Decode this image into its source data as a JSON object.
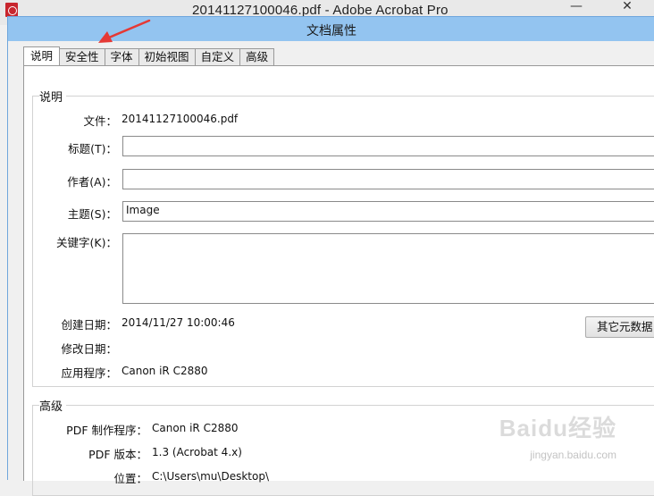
{
  "background_window": {
    "title": "20141127100046.pdf - Adobe Acrobat Pro",
    "minimize_glyph": "—",
    "close_glyph": "✕"
  },
  "dialog": {
    "title": "文档属性",
    "header_color": "#93c4f0"
  },
  "tabs": [
    {
      "label": "说明",
      "active": true
    },
    {
      "label": "安全性",
      "active": false
    },
    {
      "label": "字体",
      "active": false
    },
    {
      "label": "初始视图",
      "active": false
    },
    {
      "label": "自定义",
      "active": false
    },
    {
      "label": "高级",
      "active": false
    }
  ],
  "description": {
    "group_title": "说明",
    "file_label": "文件：",
    "file_value": "20141127100046.pdf",
    "title_label": "标题(T)：",
    "title_value": "",
    "author_label": "作者(A)：",
    "author_value": "",
    "subject_label": "主题(S)：",
    "subject_value": "Image",
    "keywords_label": "关键字(K)：",
    "keywords_value": "",
    "created_label": "创建日期：",
    "created_value": "2014/11/27 10:00:46",
    "modified_label": "修改日期：",
    "modified_value": "",
    "app_label": "应用程序：",
    "app_value": "Canon iR C2880",
    "more_metadata_button": "其它元数据"
  },
  "advanced": {
    "group_title": "高级",
    "producer_label": "PDF 制作程序：",
    "producer_value": "Canon iR C2880",
    "version_label": "PDF 版本：",
    "version_value": "1.3 (Acrobat 4.x)",
    "location_label": "位置：",
    "location_value": "C:\\Users\\mu\\Desktop\\"
  },
  "annotation": {
    "arrow_color": "#e53935"
  },
  "watermark": {
    "brand": "Baidu经验",
    "url": "jingyan.baidu.com"
  }
}
